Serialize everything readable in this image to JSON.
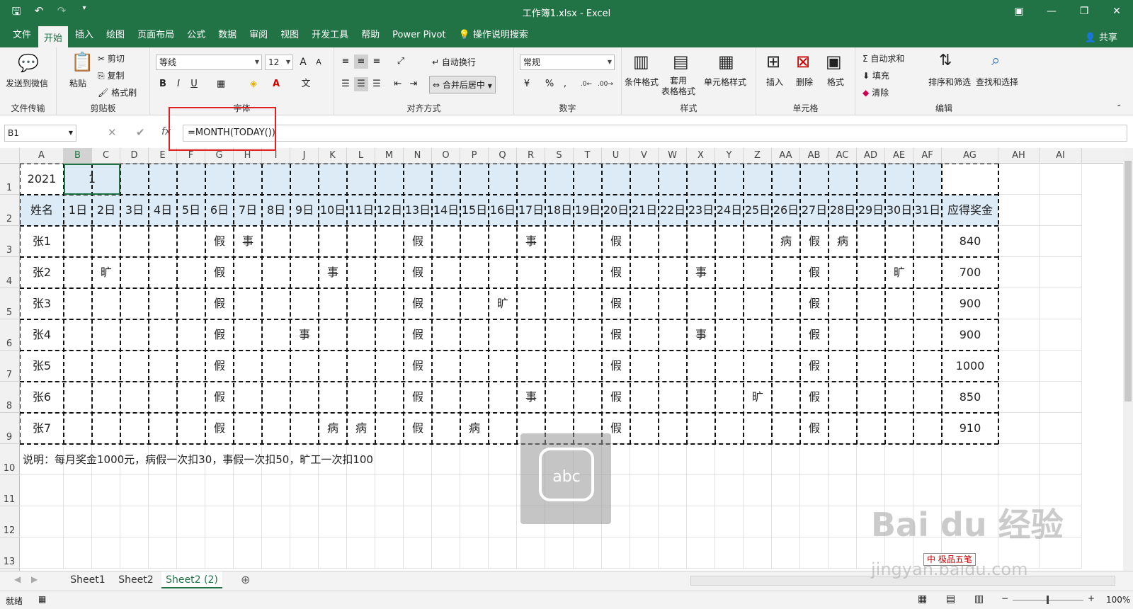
{
  "window": {
    "title": "工作簿1.xlsx  -  Excel"
  },
  "qat": {
    "save": "🖫",
    "undo": "↶",
    "redo": "↷",
    "more": "▾"
  },
  "controls": {
    "ribbon_opts": "▣",
    "minimize": "—",
    "restore": "❐",
    "close": "✕"
  },
  "tabs": [
    "文件",
    "开始",
    "插入",
    "绘图",
    "页面布局",
    "公式",
    "数据",
    "审阅",
    "视图",
    "开发工具",
    "帮助",
    "Power Pivot",
    "操作说明搜索"
  ],
  "share": "共享",
  "ribbon": {
    "file_transfer": {
      "send_wechat": "发送到微信",
      "label": "文件传输"
    },
    "clipboard": {
      "paste": "粘贴",
      "cut": "剪切",
      "copy": "复制",
      "format_painter": "格式刷",
      "label": "剪贴板"
    },
    "font": {
      "name": "等线",
      "size": "12",
      "bold": "B",
      "italic": "I",
      "underline": "U",
      "label": "字体",
      "grow": "A",
      "shrink": "A",
      "wen": "文"
    },
    "alignment": {
      "wrap": "自动换行",
      "merge": "合并后居中",
      "label": "对齐方式"
    },
    "number": {
      "format": "常规",
      "percent": "%",
      "comma": ",",
      "label": "数字"
    },
    "styles": {
      "conditional": "条件格式",
      "table": "套用\n表格格式",
      "cell_styles": "单元格样式",
      "label": "样式"
    },
    "cells": {
      "insert": "插入",
      "delete": "删除",
      "format": "格式",
      "label": "单元格"
    },
    "editing": {
      "autosum": "自动求和",
      "fill": "填充",
      "clear": "清除",
      "sort": "排序和筛选",
      "find": "查找和选择",
      "label": "编辑"
    }
  },
  "formula_bar": {
    "name_box": "B1",
    "fx": "fx",
    "content": "=MONTH(TODAY())"
  },
  "columns": [
    "A",
    "B",
    "C",
    "D",
    "E",
    "F",
    "G",
    "H",
    "I",
    "J",
    "K",
    "L",
    "M",
    "N",
    "O",
    "P",
    "Q",
    "R",
    "S",
    "T",
    "U",
    "V",
    "W",
    "X",
    "Y",
    "Z",
    "AA",
    "AB",
    "AC",
    "AD",
    "AE",
    "AF",
    "AG",
    "AH",
    "AI"
  ],
  "rows": [
    "1",
    "2",
    "3",
    "4",
    "5",
    "6",
    "7",
    "8",
    "9",
    "10",
    "11",
    "12",
    "13"
  ],
  "sheet": {
    "year": "2021",
    "month": "1",
    "header": [
      "姓名",
      "1日",
      "2日",
      "3日",
      "4日",
      "5日",
      "6日",
      "7日",
      "8日",
      "9日",
      "10日",
      "11日",
      "12日",
      "13日",
      "14日",
      "15日",
      "16日",
      "17日",
      "18日",
      "19日",
      "20日",
      "21日",
      "22日",
      "23日",
      "24日",
      "25日",
      "26日",
      "27日",
      "28日",
      "29日",
      "30日",
      "31日",
      "应得奖金"
    ],
    "records": [
      {
        "name": "张1",
        "marks": {
          "6": "假",
          "7": "事",
          "13": "假",
          "17": "事",
          "20": "假",
          "26": "病",
          "27": "假",
          "28": "病"
        },
        "bonus": "840"
      },
      {
        "name": "张2",
        "marks": {
          "2": "旷",
          "6": "假",
          "10": "事",
          "13": "假",
          "20": "假",
          "23": "事",
          "27": "假",
          "30": "旷"
        },
        "bonus": "700"
      },
      {
        "name": "张3",
        "marks": {
          "6": "假",
          "13": "假",
          "16": "旷",
          "20": "假",
          "27": "假"
        },
        "bonus": "900"
      },
      {
        "name": "张4",
        "marks": {
          "6": "假",
          "9": "事",
          "13": "假",
          "20": "假",
          "23": "事",
          "27": "假"
        },
        "bonus": "900"
      },
      {
        "name": "张5",
        "marks": {
          "6": "假",
          "13": "假",
          "20": "假",
          "27": "假"
        },
        "bonus": "1000"
      },
      {
        "name": "张6",
        "marks": {
          "6": "假",
          "13": "假",
          "17": "事",
          "20": "假",
          "25": "旷",
          "27": "假"
        },
        "bonus": "850"
      },
      {
        "name": "张7",
        "marks": {
          "6": "假",
          "10": "病",
          "11": "病",
          "13": "假",
          "15": "病",
          "20": "假",
          "27": "假"
        },
        "bonus": "910"
      }
    ],
    "note": "说明：每月奖金1000元，病假一次扣30，事假一次扣50，旷工一次扣100"
  },
  "sheet_tabs": [
    "Sheet1",
    "Sheet2",
    "Sheet2 (2)"
  ],
  "status": {
    "ready": "就绪",
    "zoom": "100%"
  },
  "ime": {
    "label": "abc",
    "bar": "中 极品五笔"
  },
  "watermark": {
    "logo": "Bai du 经验",
    "url": "jingyan.baidu.com"
  }
}
